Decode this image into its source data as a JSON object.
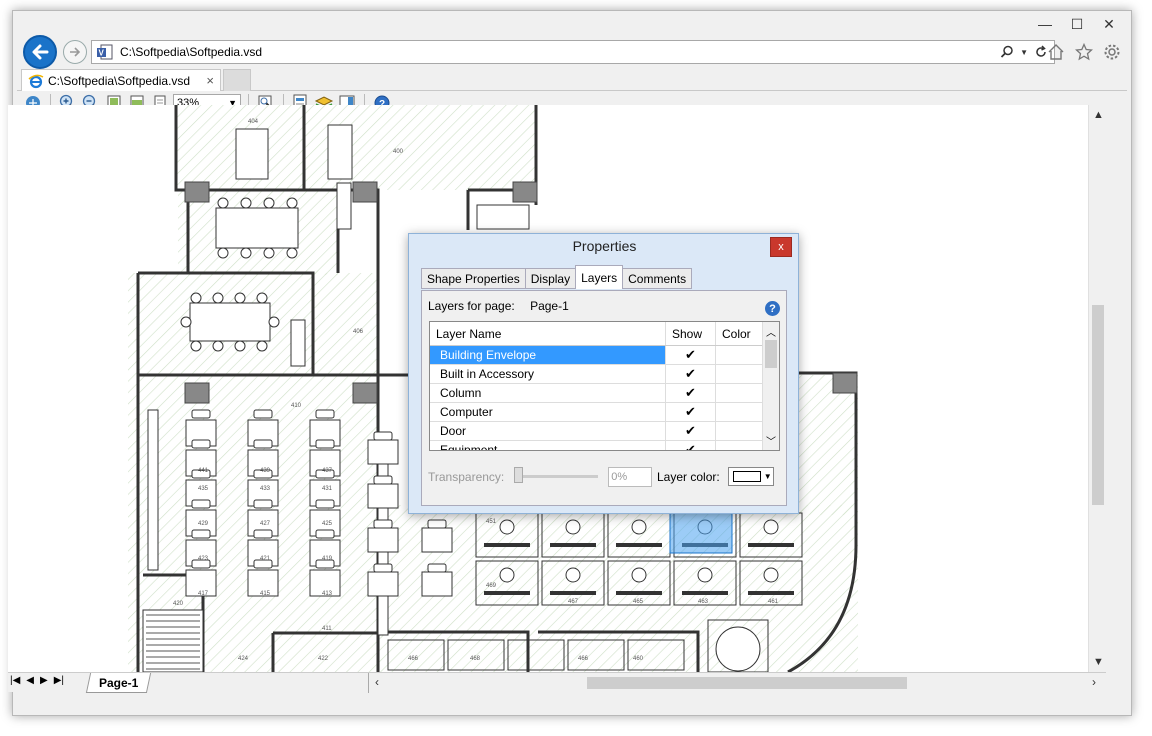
{
  "browser": {
    "url": "C:\\Softpedia\\Softpedia.vsd",
    "tab_title": "C:\\Softpedia\\Softpedia.vsd",
    "tab_close": "×",
    "caption": {
      "min": "—",
      "max": "☐",
      "close": "✕"
    }
  },
  "toolbar": {
    "zoom": "33%"
  },
  "page_tab": "Page-1",
  "dialog": {
    "title": "Properties",
    "close": "x",
    "tabs": [
      "Shape Properties",
      "Display",
      "Layers",
      "Comments"
    ],
    "active_tab": "Layers",
    "layers_for_label": "Layers for page:",
    "page_name": "Page-1",
    "columns": {
      "name": "Layer Name",
      "show": "Show",
      "color": "Color"
    },
    "layers": [
      {
        "name": "Building Envelope",
        "show": "✔",
        "selected": true
      },
      {
        "name": "Built in Accessory",
        "show": "✔"
      },
      {
        "name": "Column",
        "show": "✔"
      },
      {
        "name": "Computer",
        "show": "✔"
      },
      {
        "name": "Door",
        "show": "✔"
      },
      {
        "name": "Equipment",
        "show": "✔"
      }
    ],
    "transparency_label": "Transparency:",
    "transparency_value": "0%",
    "layer_color_label": "Layer color:"
  },
  "floorplan_labels": [
    "404",
    "400",
    "406",
    "410",
    "441",
    "439",
    "437",
    "435",
    "433",
    "431",
    "429",
    "427",
    "425",
    "423",
    "421",
    "419",
    "417",
    "415",
    "413",
    "411",
    "420",
    "424",
    "422",
    "451",
    "469",
    "467",
    "465",
    "463",
    "461",
    "466",
    "468",
    "466",
    "460"
  ]
}
